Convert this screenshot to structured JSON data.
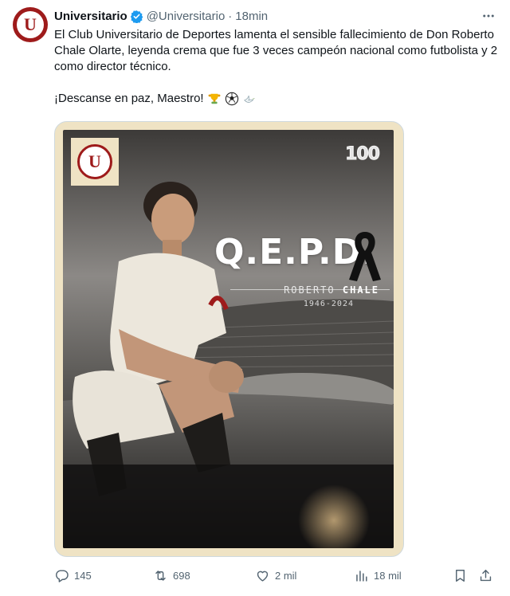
{
  "author": {
    "display_name": "Universitario",
    "handle": "@Universitario",
    "separator": "·",
    "time": "18min",
    "avatar_letter": "U"
  },
  "tweet": {
    "text": "El Club Universitario de Deportes lamenta el sensible fallecimiento de Don Roberto Chale Olarte, leyenda crema que fue 3 veces campeón nacional como futbolista y 2 como director técnico.",
    "text2": "¡Descanse en paz, Maestro!"
  },
  "media": {
    "logo_letter": "U",
    "anniversary": "100",
    "headline": "Q.E.P.D.",
    "name_first": "ROBERTO",
    "name_last": "CHALE",
    "years": "1946-2024"
  },
  "actions": {
    "replies": "145",
    "reposts": "698",
    "likes": "2 mil",
    "views": "18 mil"
  },
  "colors": {
    "brand": "#9e1b1b",
    "verified": "#1d9bf0",
    "muted": "#536471",
    "poster_border": "#efe3c4"
  },
  "icons": [
    "more-icon",
    "verified-icon",
    "reply-icon",
    "repost-icon",
    "like-icon",
    "views-icon",
    "bookmark-icon",
    "share-icon",
    "black-ribbon-icon",
    "trophy-emoji",
    "soccer-ball-emoji",
    "dove-emoji"
  ]
}
